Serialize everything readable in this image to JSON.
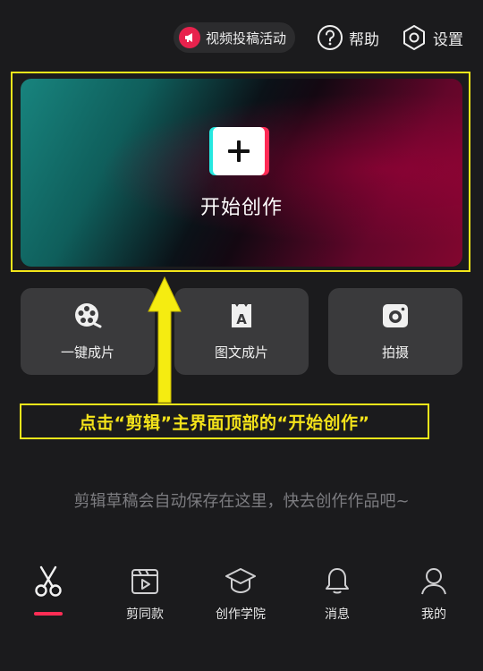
{
  "topbar": {
    "activity_label": "视频投稿活动",
    "help_label": "帮助",
    "settings_label": "设置"
  },
  "hero": {
    "label": "开始创作"
  },
  "tiles": [
    {
      "label": "一键成片",
      "icon": "film-reel-icon"
    },
    {
      "label": "图文成片",
      "icon": "text-image-icon"
    },
    {
      "label": "拍摄",
      "icon": "camera-icon"
    }
  ],
  "annotation": {
    "text": "点击“剪辑”主界面顶部的“开始创作”"
  },
  "empty_hint": "剪辑草稿会自动保存在这里，快去创作作品吧~",
  "nav": [
    {
      "label": "",
      "icon": "scissors-icon",
      "active": true
    },
    {
      "label": "剪同款",
      "icon": "template-icon"
    },
    {
      "label": "创作学院",
      "icon": "graduation-cap-icon"
    },
    {
      "label": "消息",
      "icon": "bell-icon"
    },
    {
      "label": "我的",
      "icon": "user-icon"
    }
  ],
  "colors": {
    "background": "#1b1b1d",
    "accent": "#ff2d55",
    "annotation": "#f3e61a",
    "tile": "#3a3a3c"
  }
}
